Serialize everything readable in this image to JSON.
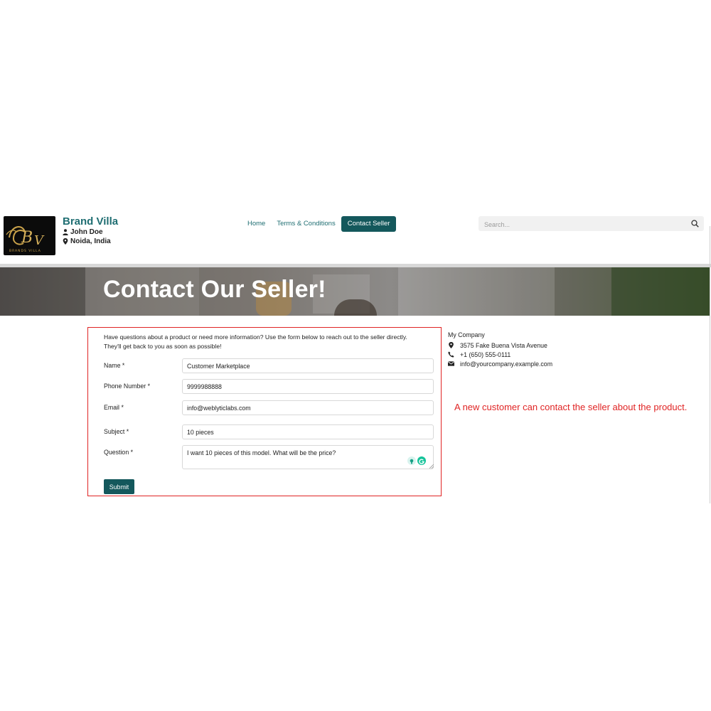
{
  "header": {
    "brand_name": "Brand Villa",
    "seller_name": "John Doe",
    "seller_location": "Noida, India",
    "logo_text": "BRANDS VILLA",
    "nav": [
      {
        "label": "Home"
      },
      {
        "label": "Terms & Conditions"
      },
      {
        "label": "Contact Seller",
        "active": true
      }
    ],
    "search_placeholder": "Search..."
  },
  "banner": {
    "title": "Contact Our Seller!"
  },
  "form": {
    "intro": "Have questions about a product or need more information? Use the form below to reach out to the seller directly. They'll get back to you as soon as possible!",
    "fields": {
      "name": {
        "label": "Name *",
        "value": "Customer Marketplace"
      },
      "phone": {
        "label": "Phone Number *",
        "value": "9999988888"
      },
      "email": {
        "label": "Email *",
        "value": "info@weblyticlabs.com"
      },
      "subject": {
        "label": "Subject *",
        "value": "10 pieces"
      },
      "question": {
        "label": "Question *",
        "value": "I want 10 pieces of this model. What will be the price?"
      }
    },
    "submit_label": "Submit"
  },
  "company": {
    "name": "My Company",
    "address": "3575 Fake Buena Vista Avenue",
    "phone": "+1 (650) 555-0111",
    "email": "info@yourcompany.example.com"
  },
  "annotation": "A new customer can contact the seller about the product.",
  "colors": {
    "accent": "#14585c",
    "brand_text": "#1f6e72",
    "highlight_border": "#e02424"
  },
  "icons": [
    "user-icon",
    "map-marker-icon",
    "search-icon",
    "phone-icon",
    "envelope-icon",
    "grammarly-icon"
  ]
}
